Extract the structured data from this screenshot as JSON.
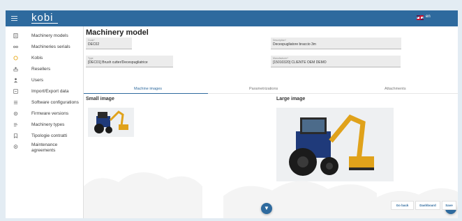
{
  "app": {
    "logo": "kobi",
    "language": "en"
  },
  "sidebar": {
    "items": [
      {
        "label": "Machinery models",
        "icon": "document-icon"
      },
      {
        "label": "Machineries serials",
        "icon": "serials-icon"
      },
      {
        "label": "Kobis",
        "icon": "kobi-device-icon"
      },
      {
        "label": "Resellers",
        "icon": "resellers-icon"
      },
      {
        "label": "Users",
        "icon": "user-icon"
      },
      {
        "label": "Import/Export data",
        "icon": "import-export-icon"
      },
      {
        "label": "Software configurations",
        "icon": "sliders-icon"
      },
      {
        "label": "Firmware versions",
        "icon": "firmware-icon"
      },
      {
        "label": "Machinery types",
        "icon": "list-icon"
      },
      {
        "label": "Tipologie contratti",
        "icon": "bookmark-icon"
      },
      {
        "label": "Maintenance agreements",
        "label_line1": "Maintenance",
        "label_line2": "agreements",
        "icon": "agreement-icon"
      }
    ]
  },
  "main": {
    "title": "Machinery model",
    "fields": {
      "code": {
        "label": "Code*",
        "value": "DEC02"
      },
      "description": {
        "label": "Description*",
        "value": "Decespugliatore braccio 3m"
      },
      "type": {
        "label": "Type",
        "value": "[DEC01] Brush cutter/Decespugliatrice"
      },
      "manufacturer": {
        "label": "Manufacturer*",
        "value": "[15010320] CLIENTE OEM DEMO"
      }
    },
    "tabs": [
      {
        "label": "Machine images",
        "active": true
      },
      {
        "label": "Parametrizations",
        "active": false
      },
      {
        "label": "Attachments",
        "active": false
      }
    ],
    "small_image_title": "Small image",
    "large_image_title": "Large image",
    "images": {
      "small": "tractor-with-brush-cutter-arm",
      "large": "tractor-with-brush-cutter-arm"
    }
  },
  "actions": {
    "go_back": "Go back",
    "dashboard": "Dashboard",
    "save": "Save"
  },
  "colors": {
    "primary": "#2e6a9e",
    "background": "#e3ecf3",
    "field_bg": "#ececec"
  }
}
